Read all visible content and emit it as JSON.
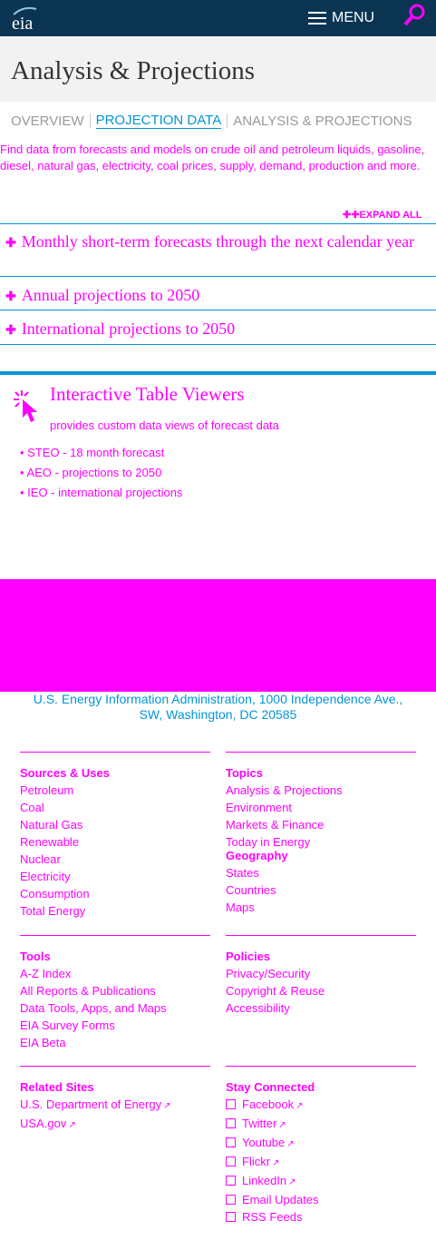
{
  "header": {
    "logo_text": "eia",
    "menu_label": "MENU"
  },
  "page_title": "Analysis & Projections",
  "tabs": [
    {
      "label": "OVERVIEW",
      "active": false
    },
    {
      "label": "PROJECTION DATA",
      "active": true
    },
    {
      "label": "ANALYSIS & PROJECTIONS",
      "active": false
    }
  ],
  "intro_text": "Find data from forecasts and models on crude oil and petroleum liquids, gasoline, diesel, natural gas, electricity, coal prices, supply, demand, production and more.",
  "expand_all_label": "EXPAND ALL",
  "accordion": [
    {
      "label": "Monthly short-term forecasts through the next calendar year"
    },
    {
      "label": "Annual projections to 2050"
    },
    {
      "label": "International projections to 2050"
    }
  ],
  "interactive_viewers": {
    "title": "Interactive Table Viewers",
    "description": "provides custom data views of forecast data",
    "items": [
      {
        "label": "STEO - 18 month forecast"
      },
      {
        "label": "AEO - projections to 2050"
      },
      {
        "label": "IEO - international projections"
      }
    ]
  },
  "footer": {
    "address_line1": "U.S. Energy Information Administration, 1000 Independence Ave.,",
    "address_line2": "SW, Washington, DC 20585",
    "sources_heading": "Sources & Uses",
    "sources": [
      "Petroleum",
      "Coal",
      "Natural Gas",
      "Renewable",
      "Nuclear",
      "Electricity",
      "Consumption",
      "Total Energy"
    ],
    "topics_heading": "Topics",
    "topics": [
      "Analysis & Projections",
      "Environment",
      "Markets & Finance",
      "Today in Energy"
    ],
    "geography_heading": "Geography",
    "geography": [
      "States",
      "Countries",
      "Maps"
    ],
    "tools_heading": "Tools",
    "tools": [
      "A-Z Index",
      "All Reports & Publications",
      "Data Tools, Apps, and Maps",
      "EIA Survey Forms",
      "EIA Beta"
    ],
    "policies_heading": "Policies",
    "policies": [
      "Privacy/Security",
      "Copyright & Reuse",
      "Accessibility"
    ],
    "related_heading": "Related Sites",
    "related": [
      "U.S. Department of Energy",
      "USA.gov"
    ],
    "connected_heading": "Stay Connected",
    "connected": [
      "Facebook",
      "Twitter",
      "Youtube",
      "Flickr",
      "LinkedIn",
      "Email Updates",
      "RSS Feeds"
    ]
  },
  "colors": {
    "header_bg": "#0a3452",
    "accent_blue": "#0096d6",
    "highlight": "#ff00ff"
  }
}
